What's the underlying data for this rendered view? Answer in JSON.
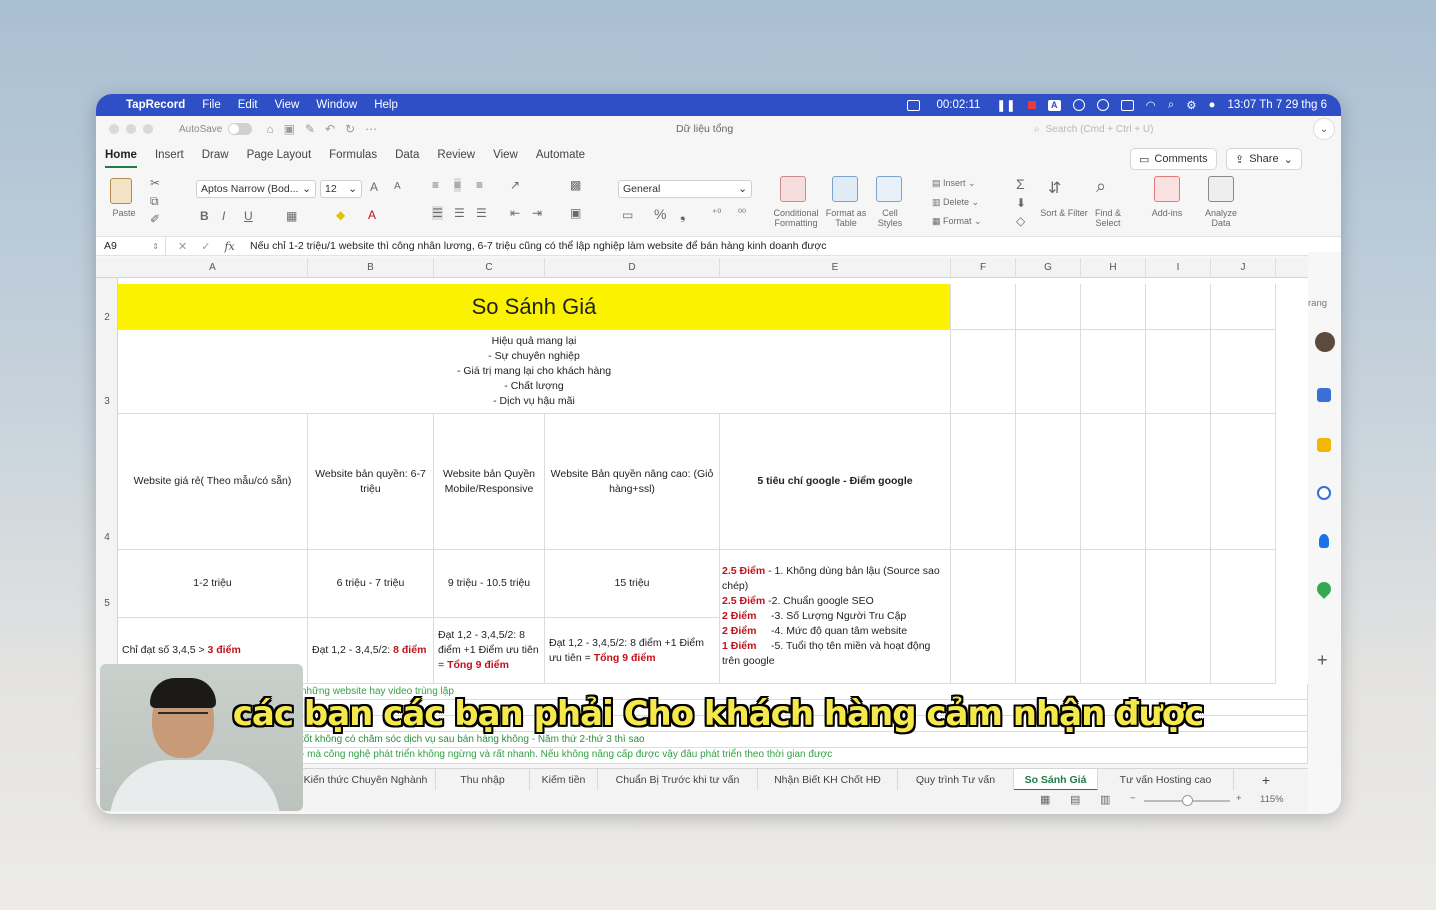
{
  "menubar": {
    "app_name": "TapRecord",
    "items": [
      "File",
      "Edit",
      "View",
      "Window",
      "Help"
    ],
    "rec_time": "00:02:11",
    "input_badge": "A",
    "datetime": "13:07 Th 7 29 thg 6"
  },
  "titlebar": {
    "autosave_label": "AutoSave",
    "document_title": "Dữ liệu tổng",
    "search_placeholder": "Search (Cmd + Ctrl + U)"
  },
  "ribbon_tabs": [
    "Home",
    "Insert",
    "Draw",
    "Page Layout",
    "Formulas",
    "Data",
    "Review",
    "View",
    "Automate"
  ],
  "ribbon_buttons": {
    "comments": "Comments",
    "share": "Share",
    "paste": "Paste",
    "font_name": "Aptos Narrow (Bod...",
    "font_size": "12",
    "number_format": "General",
    "conditional_formatting": "Conditional Formatting",
    "format_as_table": "Format as Table",
    "cell_styles": "Cell Styles",
    "insert": "Insert",
    "delete": "Delete",
    "format": "Format",
    "sort_filter": "Sort & Filter",
    "find_select": "Find & Select",
    "add_ins": "Add-ins",
    "analyze_data": "Analyze Data"
  },
  "formula_bar": {
    "name_box": "A9",
    "formula": "Nếu chỉ 1-2 triệu/1 website thì công nhân lương, 6-7 triệu cũng có thể lập nghiệp làm website để bán hàng kinh doanh được"
  },
  "columns": [
    "A",
    "B",
    "C",
    "D",
    "E",
    "F",
    "G",
    "H",
    "I",
    "J"
  ],
  "rows": [
    "2",
    "3",
    "4",
    "5"
  ],
  "sheet": {
    "title": "So Sánh Giá",
    "intro_lines": [
      "Hiệu quả mang lại",
      "- Sự chuyên nghiệp",
      "- Giá trị mang lại cho khách hàng",
      "- Chất lượng",
      "-  Dịch vụ hậu mãi"
    ],
    "headers": [
      "Website giá rẻ( Theo mẫu/có sẵn)",
      "Website bản quyền: 6-7 triệu",
      "Website bản Quyền Mobile/Responsive",
      "Website Bản quyền nâng cao: (Giỏ hàng+ssl)",
      "5 tiêu chí google - Điểm google"
    ],
    "prices": [
      "1-2 triệu",
      "6 triệu - 7 triệu",
      "9 triệu - 10.5 triệu",
      "15 triệu"
    ],
    "criteria": [
      {
        "points": "2.5 Điểm",
        "text": " - 1. Không dùng bản lậu (Source sao chép)"
      },
      {
        "points": "2.5 Điểm",
        "text": " -2. Chuẩn google SEO"
      },
      {
        "points": "2 Điểm",
        "text": "     -3. Số Lượng Người Tru Cập"
      },
      {
        "points": "2 Điểm",
        "text": "     -4. Mức độ quan tâm website"
      },
      {
        "points": "1 Điểm",
        "text": "     -5. Tuổi thọ tên miền và hoạt động trên google"
      }
    ],
    "scores": {
      "a_text": "Chỉ đạt số 3,4,5 > ",
      "a_score": "3 điểm",
      "b_text": "Đạt 1,2 - 3,4,5/2: ",
      "b_score": "8 điểm",
      "c_text": "Đạt 1,2 - 3,4,5/2: 8 điểm +1 Điểm ưu tiên = ",
      "c_score": "Tổng 9 điểm",
      "d_text": "Đạt 1,2 - 3,4,5/2: 8 điểm +1 Điểm ưu tiên = ",
      "d_score": "Tổng 9 điểm"
    },
    "notes": [
      "những website hay video trùng lặp",
      "tốt không  có chăm sóc dịch vụ sau bán hàng không - Năm thứ 2-thứ 3 thì sao",
      "- mà công nghệ phát triển không ngừng và rất nhanh. Nếu không nâng cấp được vậy đâu phát triển theo thời gian được"
    ]
  },
  "sheet_tabs": [
    "Kiến thức Chuyên Nghành",
    "Thu nhập",
    "Kiếm tiền",
    "Chuẩn Bị Trước khi tư vấn",
    "Nhận Biết KH Chốt HĐ",
    "Quy trình Tư vấn",
    "So Sánh Giá",
    "Tư vấn Hosting cao"
  ],
  "active_sheet": "So Sánh Giá",
  "status": {
    "zoom": "115%"
  },
  "side_label": "rang",
  "subtitle": "các bạn các bạn phải Cho khách hàng cảm nhận được"
}
